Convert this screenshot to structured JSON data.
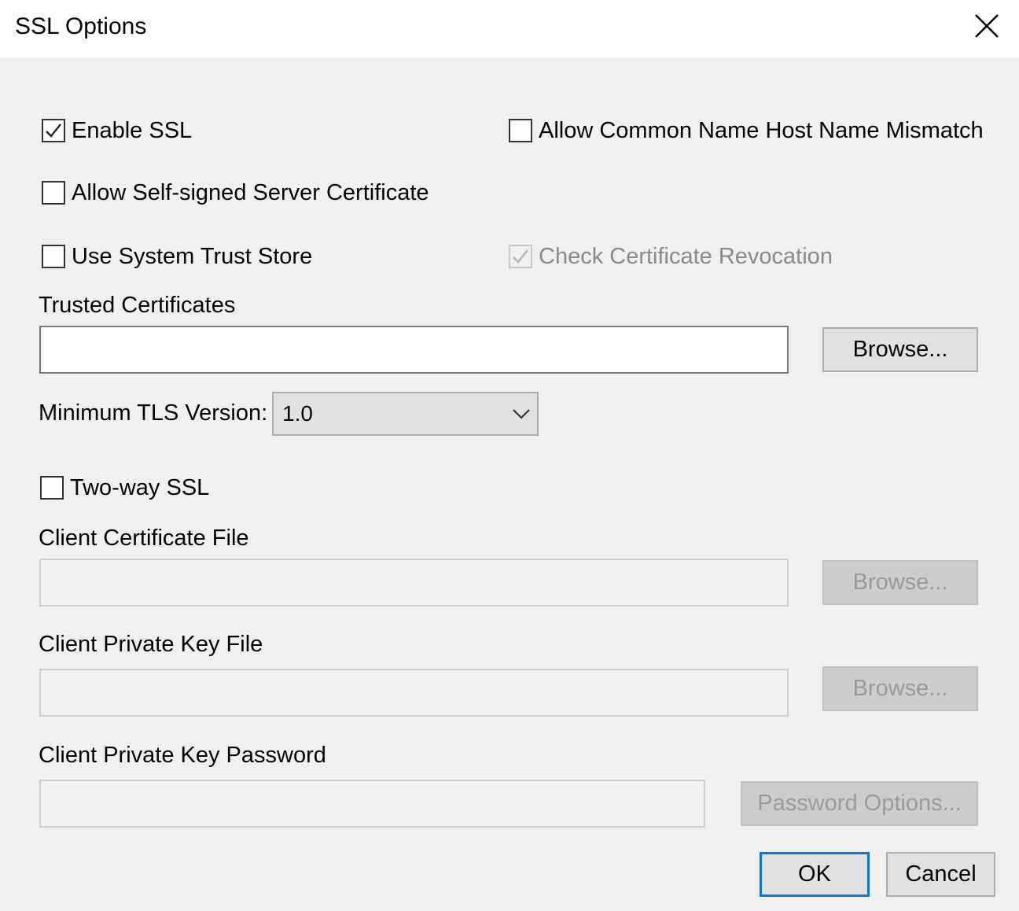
{
  "window": {
    "title": "SSL Options",
    "close_icon": "close-icon"
  },
  "options": {
    "enable_ssl": {
      "label": "Enable SSL",
      "checked": true
    },
    "allow_cn_mismatch": {
      "label": "Allow Common Name Host Name Mismatch",
      "checked": false
    },
    "allow_self_signed": {
      "label": "Allow Self-signed Server Certificate",
      "checked": false
    },
    "use_system_trust_store": {
      "label": "Use System Trust Store",
      "checked": false
    },
    "check_revocation": {
      "label": "Check Certificate Revocation",
      "checked": true,
      "disabled": true
    }
  },
  "trusted_certificates": {
    "label": "Trusted Certificates",
    "value": "",
    "browse_label": "Browse..."
  },
  "tls": {
    "label": "Minimum TLS Version:",
    "selected": "1.0"
  },
  "two_way_ssl": {
    "label": "Two-way SSL",
    "checked": false
  },
  "client_cert": {
    "label": "Client Certificate File",
    "value": "",
    "browse_label": "Browse..."
  },
  "client_key": {
    "label": "Client Private Key File",
    "value": "",
    "browse_label": "Browse..."
  },
  "client_key_password": {
    "label": "Client Private Key Password",
    "value": "",
    "options_label": "Password Options..."
  },
  "footer": {
    "ok_label": "OK",
    "cancel_label": "Cancel"
  },
  "colors": {
    "accent": "#0078d7",
    "dialog_bg": "#f0f0f0",
    "titlebar_bg": "#ffffff"
  }
}
